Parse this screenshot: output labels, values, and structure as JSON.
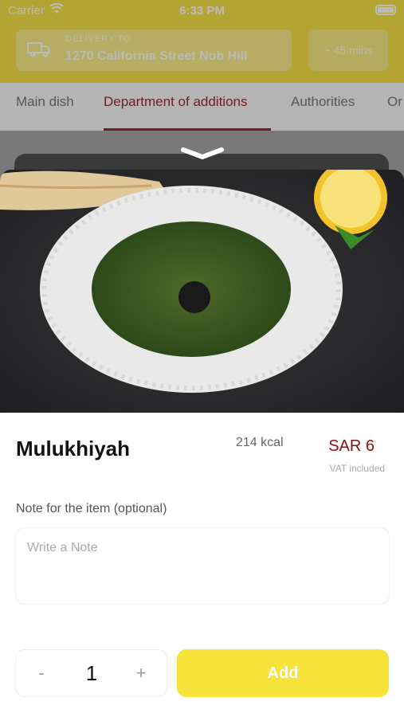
{
  "status_bar": {
    "carrier": "Carrier",
    "time": "6:33 PM"
  },
  "header": {
    "delivery_label": "DELIVERY TO",
    "delivery_address": "1270 California Street Nob Hill",
    "eta": "~ 45 mins"
  },
  "tabs": [
    {
      "label": "Main dish"
    },
    {
      "label": "Department of additions"
    },
    {
      "label": "Authorities"
    },
    {
      "label": "Or"
    }
  ],
  "active_tab": "Department of additions",
  "item": {
    "name": "Mulukhiyah",
    "calories": "214 kcal",
    "price": "SAR 6",
    "vat_note": "VAT included"
  },
  "note": {
    "label": "Note for the item (optional)",
    "placeholder": "Write a Note",
    "value": ""
  },
  "quantity": {
    "minus_label": "-",
    "value": "1",
    "plus_label": "+"
  },
  "add_label": "Add",
  "colors": {
    "brand_yellow": "#f6e43b",
    "accent_red": "#8b0f0f"
  }
}
